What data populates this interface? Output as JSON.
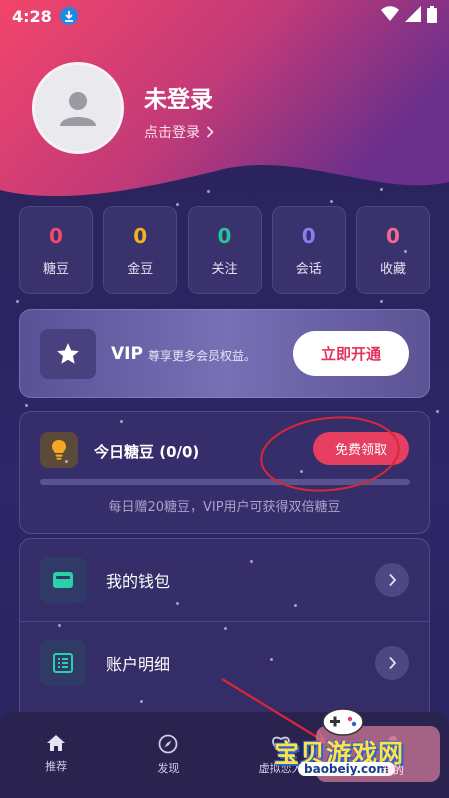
{
  "status_bar": {
    "time": "4:28"
  },
  "profile": {
    "name": "未登录",
    "login_link": "点击登录"
  },
  "stats": [
    {
      "value": "0",
      "label": "糖豆",
      "color": "#f04a6c"
    },
    {
      "value": "0",
      "label": "金豆",
      "color": "#f2b21d"
    },
    {
      "value": "0",
      "label": "关注",
      "color": "#27c39a"
    },
    {
      "value": "0",
      "label": "会话",
      "color": "#8b7cf2"
    },
    {
      "value": "0",
      "label": "收藏",
      "color": "#f06a8f"
    }
  ],
  "vip": {
    "title": "VIP",
    "description": "尊享更多会员权益。",
    "button": "立即开通"
  },
  "candy": {
    "title": "今日糖豆 (0/0)",
    "claim_button": "免费领取",
    "progress": 0,
    "note": "每日赠20糖豆，VIP用户可获得双倍糖豆"
  },
  "menu": [
    {
      "label": "我的钱包",
      "icon": "wallet-icon"
    },
    {
      "label": "账户明细",
      "icon": "list-icon"
    }
  ],
  "tabbar": [
    {
      "label": "推荐",
      "icon": "home-icon"
    },
    {
      "label": "发现",
      "icon": "compass-icon"
    },
    {
      "label": "虚拟恋人",
      "icon": "heart-icon"
    },
    {
      "label": "我的",
      "icon": "user-icon"
    }
  ],
  "watermark": {
    "title": "宝贝游戏网",
    "url": "baobeiy.com"
  },
  "colors": {
    "accent": "#e63e61",
    "header_gradient_start": "#f0456a",
    "header_gradient_end": "#6a2f8a"
  }
}
